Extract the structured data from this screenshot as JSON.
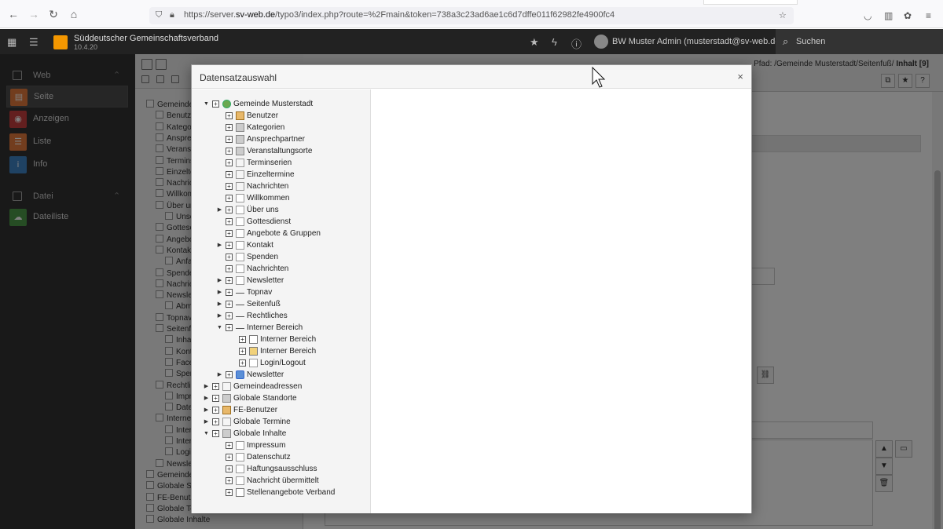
{
  "browser": {
    "url_prefix": "https://server.",
    "url_domain": "sv-web.de",
    "url_rest": "/typo3/index.php?route=%2Fmain&token=738a3c23ad6ae1c6d7dffe011f62982fe4900fc4"
  },
  "topbar": {
    "site_name": "Süddeutscher Gemeinschaftsverband",
    "version": "10.4.20",
    "user": "BW Muster Admin (musterstadt@sv-web.de)",
    "search_label": "Suchen"
  },
  "modules": {
    "groups": [
      {
        "label": "Web",
        "items": [
          {
            "label": "Seite",
            "color": "#e57a3c",
            "active": true
          },
          {
            "label": "Anzeigen",
            "color": "#c73e3e",
            "active": false
          },
          {
            "label": "Liste",
            "color": "#e57a3c",
            "active": false
          },
          {
            "label": "Info",
            "color": "#3f85c6",
            "active": false
          }
        ]
      },
      {
        "label": "Datei",
        "items": [
          {
            "label": "Dateiliste",
            "color": "#4c9a49",
            "active": false
          }
        ]
      }
    ]
  },
  "pagetree_bg": [
    "Gemeinde",
    "Benutz",
    "Kategor",
    "Anspre",
    "Veranst",
    "Termins",
    "Einzelte",
    "Nachric",
    "Willkom",
    "Über ur",
    "Unse",
    "Gottesc",
    "Angebo",
    "Kontakt",
    "Anfa",
    "Spende",
    "Nachric",
    "Newsle",
    "Abm",
    "Topnav",
    "Seitenf",
    "Inha",
    "Kont",
    "Facel",
    "Sper",
    "Rechtlic",
    "Impr",
    "Date",
    "Interne",
    "Inter",
    "Inter",
    "Logi",
    "Newsle",
    "Gemeinde",
    "Globale St",
    "FE-Benutz",
    "Globale Te",
    "Globale Inhalte"
  ],
  "docheader": {
    "path_label": "Pfad: /Gemeinde Musterstadt/Seitenfuß/",
    "path_current": "Inhalt [9]"
  },
  "modal": {
    "title": "Datensatzauswahl",
    "close": "×",
    "tree": [
      {
        "label": "Gemeinde Musterstadt",
        "level": 0,
        "toggle": "open",
        "icon": "root"
      },
      {
        "label": "Benutzer",
        "level": 1,
        "toggle": "none",
        "icon": "user"
      },
      {
        "label": "Kategorien",
        "level": 1,
        "toggle": "none",
        "icon": "folder"
      },
      {
        "label": "Ansprechpartner",
        "level": 1,
        "toggle": "none",
        "icon": "folder"
      },
      {
        "label": "Veranstaltungsorte",
        "level": 1,
        "toggle": "none",
        "icon": "folder"
      },
      {
        "label": "Terminserien",
        "level": 1,
        "toggle": "none",
        "icon": "sysf"
      },
      {
        "label": "Einzeltermine",
        "level": 1,
        "toggle": "none",
        "icon": "sysf"
      },
      {
        "label": "Nachrichten",
        "level": 1,
        "toggle": "none",
        "icon": "sysf"
      },
      {
        "label": "Willkommen",
        "level": 1,
        "toggle": "none",
        "icon": "page"
      },
      {
        "label": "Über uns",
        "level": 1,
        "toggle": "closed",
        "icon": "page"
      },
      {
        "label": "Gottesdienst",
        "level": 1,
        "toggle": "none",
        "icon": "page"
      },
      {
        "label": "Angebote & Gruppen",
        "level": 1,
        "toggle": "none",
        "icon": "page"
      },
      {
        "label": "Kontakt",
        "level": 1,
        "toggle": "closed",
        "icon": "page"
      },
      {
        "label": "Spenden",
        "level": 1,
        "toggle": "none",
        "icon": "page"
      },
      {
        "label": "Nachrichten",
        "level": 1,
        "toggle": "none",
        "icon": "page"
      },
      {
        "label": "Newsletter",
        "level": 1,
        "toggle": "closed",
        "icon": "page"
      },
      {
        "label": "Topnav",
        "level": 1,
        "toggle": "closed",
        "icon": "spacer"
      },
      {
        "label": "Seitenfuß",
        "level": 1,
        "toggle": "closed",
        "icon": "spacer"
      },
      {
        "label": "Rechtliches",
        "level": 1,
        "toggle": "closed",
        "icon": "spacer"
      },
      {
        "label": "Interner Bereich",
        "level": 1,
        "toggle": "open",
        "icon": "spacer"
      },
      {
        "label": "Interner Bereich",
        "level": 2,
        "toggle": "none",
        "icon": "login"
      },
      {
        "label": "Interner Bereich",
        "level": 2,
        "toggle": "none",
        "icon": "person"
      },
      {
        "label": "Login/Logout",
        "level": 2,
        "toggle": "none",
        "icon": "page"
      },
      {
        "label": "Newsletter",
        "level": 1,
        "toggle": "closed",
        "icon": "news"
      },
      {
        "label": "Gemeindeadressen",
        "level": 0,
        "toggle": "closed",
        "icon": "sysf"
      },
      {
        "label": "Globale Standorte",
        "level": 0,
        "toggle": "closed",
        "icon": "folder"
      },
      {
        "label": "FE-Benutzer",
        "level": 0,
        "toggle": "closed",
        "icon": "user"
      },
      {
        "label": "Globale Termine",
        "level": 0,
        "toggle": "closed",
        "icon": "sysf"
      },
      {
        "label": "Globale Inhalte",
        "level": 0,
        "toggle": "open",
        "icon": "folder"
      },
      {
        "label": "Impressum",
        "level": 1,
        "toggle": "none",
        "icon": "page"
      },
      {
        "label": "Datenschutz",
        "level": 1,
        "toggle": "none",
        "icon": "page"
      },
      {
        "label": "Haftungsausschluss",
        "level": 1,
        "toggle": "none",
        "icon": "page"
      },
      {
        "label": "Nachricht übermittelt",
        "level": 1,
        "toggle": "none",
        "icon": "page"
      },
      {
        "label": "Stellenangebote Verband",
        "level": 1,
        "toggle": "none",
        "icon": "login"
      }
    ]
  }
}
